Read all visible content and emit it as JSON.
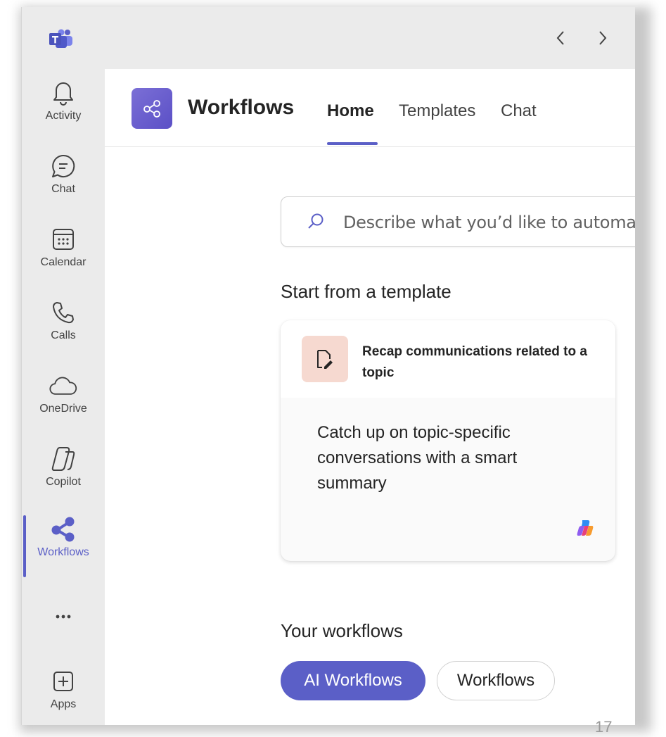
{
  "app_bar": {
    "back_label": "<",
    "forward_label": ">"
  },
  "rail": {
    "items": [
      {
        "label": "Activity",
        "icon": "bell-icon"
      },
      {
        "label": "Chat",
        "icon": "chat-bubble-icon"
      },
      {
        "label": "Calendar",
        "icon": "calendar-icon"
      },
      {
        "label": "Calls",
        "icon": "phone-icon"
      },
      {
        "label": "OneDrive",
        "icon": "cloud-icon"
      },
      {
        "label": "Copilot",
        "icon": "copilot-icon"
      },
      {
        "label": "Workflows",
        "icon": "workflows-icon",
        "active": true
      },
      {
        "label": "",
        "icon": "more-icon"
      },
      {
        "label": "Apps",
        "icon": "add-apps-icon"
      }
    ]
  },
  "header": {
    "title": "Workflows",
    "tabs": [
      {
        "label": "Home",
        "active": true
      },
      {
        "label": "Templates"
      },
      {
        "label": "Chat"
      }
    ]
  },
  "search": {
    "placeholder": "Describe what you’d like to automate"
  },
  "templates": {
    "heading": "Start from a template",
    "card": {
      "title": "Recap communications related to a topic",
      "description": "Catch up on topic-specific conversations with a smart summary",
      "icon": "document-edit-icon",
      "badge_icon": "copilot-logo-icon"
    }
  },
  "your_workflows": {
    "heading": "Your workflows",
    "filters": [
      {
        "label": "AI Workflows",
        "selected": true
      },
      {
        "label": "Workflows",
        "selected": false
      }
    ]
  },
  "footer": {
    "page_number": "17"
  },
  "colors": {
    "accent": "#5b5fc7",
    "rail_bg": "#ebebeb",
    "card_icon_bg": "#f6d9d0"
  }
}
